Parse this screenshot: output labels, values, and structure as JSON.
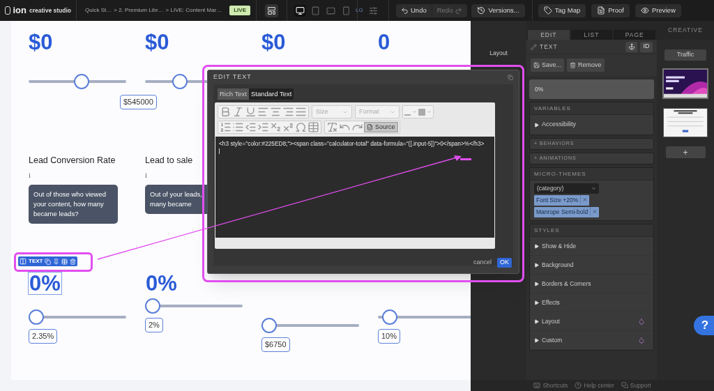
{
  "top_bar": {
    "logo": "ion",
    "product": "creative studio",
    "breadcrumbs": [
      "Quick St…",
      "> 2. Premium Libr…",
      "> LIVE: Content Mar…"
    ],
    "status_badge": "LIVE",
    "devices": [
      {
        "kind": "desktop",
        "selected": true
      },
      {
        "kind": "tablet",
        "selected": false
      },
      {
        "kind": "landscape",
        "selected": false
      },
      {
        "kind": "phone",
        "selected": false
      }
    ],
    "size_label": "LG",
    "history": [
      {
        "kind": "undo",
        "label": "Undo",
        "disabled": false
      },
      {
        "kind": "redo",
        "label": "Redo",
        "disabled": true
      }
    ],
    "buttons": [
      {
        "kind": "versions",
        "label": "Versions..."
      },
      {
        "kind": "tagmap",
        "label": "Tag Map"
      },
      {
        "kind": "proof",
        "label": "Proof"
      },
      {
        "kind": "preview",
        "label": "Preview"
      }
    ]
  },
  "canvas": {
    "columns": [
      {
        "value": "$0",
        "slider": {
          "level": 0.55
        },
        "bubble": "$545000",
        "label": "Lead Conversion Rate",
        "info": "i",
        "tip": "Out of those who viewed your content, how many became leads?",
        "result": "0%",
        "result_selected": true,
        "result_slider": {
          "level": 0
        },
        "result_bubble": "2.35%"
      },
      {
        "value": "$0",
        "slider": {
          "level": 0.33
        },
        "label": "Lead to sale",
        "info": "i",
        "tip": "Out of your leads,\nmany became",
        "result": "0%",
        "result_selected": false,
        "result_slider": {
          "level": 0
        },
        "result_bubble": "2%"
      },
      {
        "value": "$0",
        "result_slider": {
          "level": 0
        },
        "result_bubble": "$6750"
      },
      {
        "value": "0",
        "result_slider": {
          "level": 0.05
        },
        "result_bubble": "10%"
      }
    ],
    "element_toolbar": {
      "label": "TEXT"
    }
  },
  "dialog": {
    "title": "EDIT TEXT",
    "tabs": [
      {
        "label": "Rich Text",
        "selected": true
      },
      {
        "label": "Standard Text",
        "selected": false
      }
    ],
    "size_dropdown": "Size",
    "format_dropdown": "Format",
    "source_button": {
      "label": "Source",
      "active": true
    },
    "source_code": "<h3 style=\"color:#225ED8;\"><span class=\"calculator-total\" data-formula=\"([.input-5])\">0</span>%</h3>",
    "cancel": "cancel",
    "ok": "OK"
  },
  "layout_label": "Layout",
  "panel": {
    "tabs": [
      {
        "label": "EDIT",
        "selected": true
      },
      {
        "label": "LIST",
        "selected": false
      },
      {
        "label": "PAGE",
        "selected": false
      }
    ],
    "element_type": "TEXT",
    "id_button": "ID",
    "save": "Save...",
    "remove": "Remove",
    "content": "0%",
    "variables": {
      "title": "VARIABLES",
      "items": [
        "Accessibility"
      ]
    },
    "collapsed_sections": [
      "+ BEHAVIORS",
      "+ ANIMATIONS"
    ],
    "micro_themes": {
      "title": "MICRO-THEMES",
      "category": "(category)",
      "tags": [
        "Font Size +20%",
        "Manrope Semi-bold"
      ]
    },
    "styles": {
      "title": "STYLES",
      "items": [
        {
          "label": "Show & Hide",
          "drop": false
        },
        {
          "label": "Background",
          "drop": false
        },
        {
          "label": "Borders & Corners",
          "drop": false
        },
        {
          "label": "Effects",
          "drop": false
        },
        {
          "label": "Layout",
          "drop": true
        },
        {
          "label": "Custom",
          "drop": true
        }
      ]
    }
  },
  "creative": {
    "title": "CREATIVE",
    "flow": "Traffic",
    "pages": [
      {
        "kind": "hero",
        "selected": true
      },
      {
        "kind": "form",
        "selected": false
      }
    ],
    "add": "+"
  },
  "help": "?",
  "footer": [
    {
      "kind": "shortcuts",
      "label": "Shortcuts"
    },
    {
      "kind": "help",
      "label": "Help center"
    },
    {
      "kind": "support",
      "label": "Support"
    }
  ]
}
